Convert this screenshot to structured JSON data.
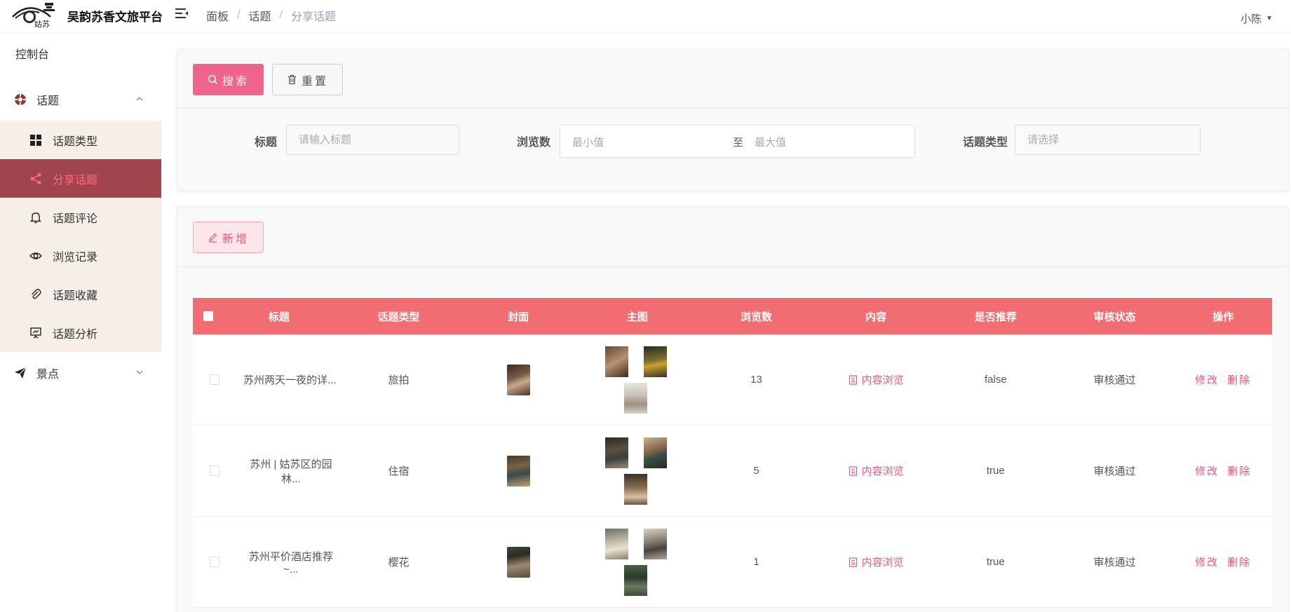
{
  "app": {
    "title": "吴韵苏香文旅平台",
    "logo_text": "姑苏"
  },
  "breadcrumb": [
    "面板",
    "话题",
    "分享话题"
  ],
  "user": {
    "name": "小陈"
  },
  "sidebar": {
    "dashboard": "控制台",
    "groups": [
      {
        "label": "话题",
        "expanded": true,
        "items": [
          {
            "label": "话题类型",
            "icon": "grid-icon"
          },
          {
            "label": "分享话题",
            "icon": "share-icon",
            "active": true
          },
          {
            "label": "话题评论",
            "icon": "bell-icon"
          },
          {
            "label": "浏览记录",
            "icon": "eye-icon"
          },
          {
            "label": "话题收藏",
            "icon": "paperclip-icon"
          },
          {
            "label": "话题分析",
            "icon": "presentation-icon"
          }
        ]
      },
      {
        "label": "景点",
        "expanded": false,
        "items": []
      }
    ]
  },
  "search": {
    "search_label": "搜索",
    "reset_label": "重置",
    "title_label": "标题",
    "title_placeholder": "请输入标题",
    "views_label": "浏览数",
    "min_placeholder": "最小值",
    "range_sep": "至",
    "max_placeholder": "最大值",
    "type_label": "话题类型",
    "type_placeholder": "请选择"
  },
  "toolbar": {
    "add_label": "新增"
  },
  "table": {
    "columns": [
      "标题",
      "话题类型",
      "封面",
      "主图",
      "浏览数",
      "内容",
      "是否推荐",
      "审核状态",
      "操作"
    ],
    "rows": [
      {
        "title": "苏州两天一夜的详...",
        "type": "旅拍",
        "views": "13",
        "content": "内容浏览",
        "recommended": "false",
        "status": "审核通过",
        "edit": "修改",
        "delete": "删除"
      },
      {
        "title": "苏州 | 姑苏区的园林...",
        "type": "住宿",
        "views": "5",
        "content": "内容浏览",
        "recommended": "true",
        "status": "审核通过",
        "edit": "修改",
        "delete": "删除"
      },
      {
        "title": "苏州平价酒店推荐~...",
        "type": "樱花",
        "views": "1",
        "content": "内容浏览",
        "recommended": "true",
        "status": "审核通过",
        "edit": "修改",
        "delete": "删除"
      }
    ]
  },
  "colors": {
    "accent": "#f0648c",
    "table_header": "#f26d72",
    "sidebar_active": "#a0454d",
    "sidebar_sub_bg": "#f5efe7",
    "link": "#e9577e"
  }
}
